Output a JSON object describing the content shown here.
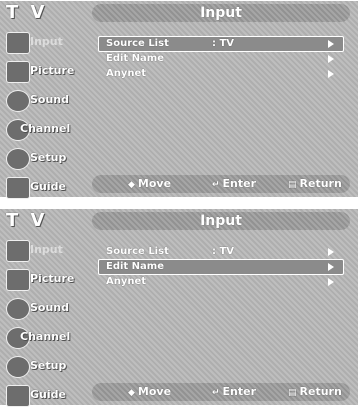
{
  "screens": [
    {
      "tv_label": "T V",
      "title": "Input",
      "sidebar": [
        {
          "label": "Input",
          "icon": "input-icon",
          "dim": true
        },
        {
          "label": "Picture",
          "icon": "picture-icon",
          "dim": false
        },
        {
          "label": "Sound",
          "icon": "sound-icon",
          "dim": false
        },
        {
          "label": "Channel",
          "icon": "channel-icon",
          "dim": false
        },
        {
          "label": "Setup",
          "icon": "setup-icon",
          "dim": false
        },
        {
          "label": "Guide",
          "icon": "guide-icon",
          "dim": false
        }
      ],
      "menu": [
        {
          "label": "Source List",
          "value": ": TV",
          "selected": true
        },
        {
          "label": "Edit Name",
          "value": "",
          "selected": false
        },
        {
          "label": "Anynet",
          "value": "",
          "selected": false
        }
      ],
      "footer": {
        "move": "Move",
        "enter": "Enter",
        "return": "Return"
      }
    },
    {
      "tv_label": "T V",
      "title": "Input",
      "sidebar": [
        {
          "label": "Input",
          "icon": "input-icon",
          "dim": true
        },
        {
          "label": "Picture",
          "icon": "picture-icon",
          "dim": false
        },
        {
          "label": "Sound",
          "icon": "sound-icon",
          "dim": false
        },
        {
          "label": "Channel",
          "icon": "channel-icon",
          "dim": false
        },
        {
          "label": "Setup",
          "icon": "setup-icon",
          "dim": false
        },
        {
          "label": "Guide",
          "icon": "guide-icon",
          "dim": false
        }
      ],
      "menu": [
        {
          "label": "Source List",
          "value": ": TV",
          "selected": false
        },
        {
          "label": "Edit Name",
          "value": "",
          "selected": true
        },
        {
          "label": "Anynet",
          "value": "",
          "selected": false
        }
      ],
      "footer": {
        "move": "Move",
        "enter": "Enter",
        "return": "Return"
      }
    }
  ],
  "colors": {
    "background": "#b9b9b9",
    "bar": "#9a9a9a",
    "highlight": "#8b8b8b",
    "text": "#ffffff"
  }
}
